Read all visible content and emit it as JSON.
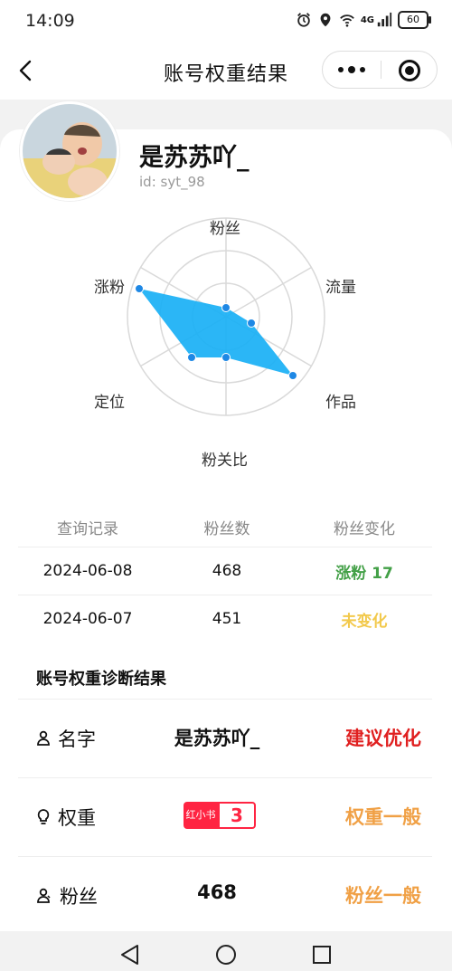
{
  "status": {
    "time": "14:09",
    "battery": "60",
    "network": "4G"
  },
  "nav": {
    "title": "账号权重结果"
  },
  "user": {
    "name": "是苏苏吖_",
    "id": "id: syt_98"
  },
  "radar": {
    "labels": {
      "fans": "粉丝",
      "traffic": "流量",
      "works": "作品",
      "ratio": "粉关比",
      "position": "定位",
      "growth": "涨粉"
    },
    "colors": {
      "fill": "#19b0f5",
      "point": "#1e88e5",
      "grid": "#d9d9d9"
    }
  },
  "history": {
    "headers": [
      "查询记录",
      "粉丝数",
      "粉丝变化"
    ],
    "rows": [
      {
        "date": "2024-06-08",
        "fans": "468",
        "change": "涨粉 17",
        "color": "#43a047"
      },
      {
        "date": "2024-06-07",
        "fans": "451",
        "change": "未变化",
        "color": "#f2c94c"
      }
    ]
  },
  "diagnosis": {
    "title": "账号权重诊断结果",
    "rows": [
      {
        "label": "名字",
        "value": "是苏苏吖_",
        "result": "建议优化",
        "color": "#e02020",
        "icon": "user-icon"
      },
      {
        "label": "权重",
        "brand": "红小书",
        "value": "3",
        "result": "权重一般",
        "color": "#f0a045",
        "icon": "bulb-icon"
      },
      {
        "label": "粉丝",
        "value": "468",
        "result": "粉丝一般",
        "color": "#f0a045",
        "icon": "users-icon"
      }
    ]
  }
}
